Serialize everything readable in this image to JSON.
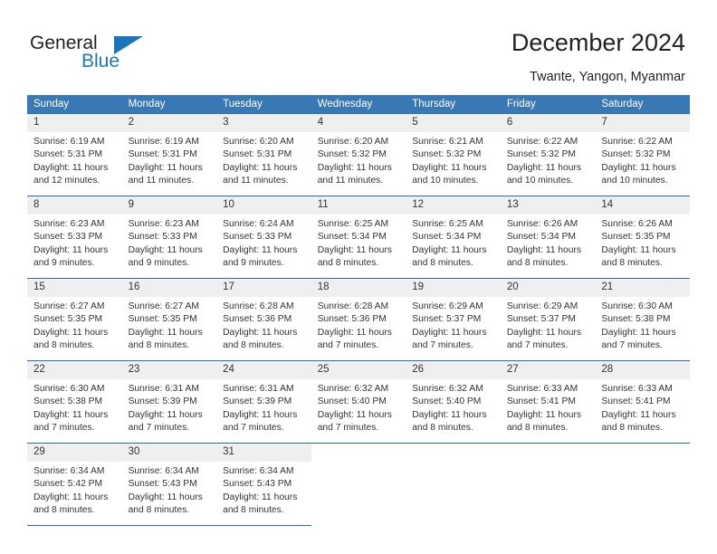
{
  "brand": {
    "word_one": "General",
    "word_two": "Blue",
    "accent_color": "#1b75bb"
  },
  "header": {
    "title": "December 2024",
    "subtitle": "Twante, Yangon, Myanmar"
  },
  "calendar": {
    "header_color": "#3878b4",
    "daynum_background": "#efefef",
    "weekday_headers": [
      "Sunday",
      "Monday",
      "Tuesday",
      "Wednesday",
      "Thursday",
      "Friday",
      "Saturday"
    ],
    "weeks": [
      [
        {
          "day": "1",
          "sunrise": "Sunrise: 6:19 AM",
          "sunset": "Sunset: 5:31 PM",
          "daylight_line1": "Daylight: 11 hours",
          "daylight_line2": "and 12 minutes."
        },
        {
          "day": "2",
          "sunrise": "Sunrise: 6:19 AM",
          "sunset": "Sunset: 5:31 PM",
          "daylight_line1": "Daylight: 11 hours",
          "daylight_line2": "and 11 minutes."
        },
        {
          "day": "3",
          "sunrise": "Sunrise: 6:20 AM",
          "sunset": "Sunset: 5:31 PM",
          "daylight_line1": "Daylight: 11 hours",
          "daylight_line2": "and 11 minutes."
        },
        {
          "day": "4",
          "sunrise": "Sunrise: 6:20 AM",
          "sunset": "Sunset: 5:32 PM",
          "daylight_line1": "Daylight: 11 hours",
          "daylight_line2": "and 11 minutes."
        },
        {
          "day": "5",
          "sunrise": "Sunrise: 6:21 AM",
          "sunset": "Sunset: 5:32 PM",
          "daylight_line1": "Daylight: 11 hours",
          "daylight_line2": "and 10 minutes."
        },
        {
          "day": "6",
          "sunrise": "Sunrise: 6:22 AM",
          "sunset": "Sunset: 5:32 PM",
          "daylight_line1": "Daylight: 11 hours",
          "daylight_line2": "and 10 minutes."
        },
        {
          "day": "7",
          "sunrise": "Sunrise: 6:22 AM",
          "sunset": "Sunset: 5:32 PM",
          "daylight_line1": "Daylight: 11 hours",
          "daylight_line2": "and 10 minutes."
        }
      ],
      [
        {
          "day": "8",
          "sunrise": "Sunrise: 6:23 AM",
          "sunset": "Sunset: 5:33 PM",
          "daylight_line1": "Daylight: 11 hours",
          "daylight_line2": "and 9 minutes."
        },
        {
          "day": "9",
          "sunrise": "Sunrise: 6:23 AM",
          "sunset": "Sunset: 5:33 PM",
          "daylight_line1": "Daylight: 11 hours",
          "daylight_line2": "and 9 minutes."
        },
        {
          "day": "10",
          "sunrise": "Sunrise: 6:24 AM",
          "sunset": "Sunset: 5:33 PM",
          "daylight_line1": "Daylight: 11 hours",
          "daylight_line2": "and 9 minutes."
        },
        {
          "day": "11",
          "sunrise": "Sunrise: 6:25 AM",
          "sunset": "Sunset: 5:34 PM",
          "daylight_line1": "Daylight: 11 hours",
          "daylight_line2": "and 8 minutes."
        },
        {
          "day": "12",
          "sunrise": "Sunrise: 6:25 AM",
          "sunset": "Sunset: 5:34 PM",
          "daylight_line1": "Daylight: 11 hours",
          "daylight_line2": "and 8 minutes."
        },
        {
          "day": "13",
          "sunrise": "Sunrise: 6:26 AM",
          "sunset": "Sunset: 5:34 PM",
          "daylight_line1": "Daylight: 11 hours",
          "daylight_line2": "and 8 minutes."
        },
        {
          "day": "14",
          "sunrise": "Sunrise: 6:26 AM",
          "sunset": "Sunset: 5:35 PM",
          "daylight_line1": "Daylight: 11 hours",
          "daylight_line2": "and 8 minutes."
        }
      ],
      [
        {
          "day": "15",
          "sunrise": "Sunrise: 6:27 AM",
          "sunset": "Sunset: 5:35 PM",
          "daylight_line1": "Daylight: 11 hours",
          "daylight_line2": "and 8 minutes."
        },
        {
          "day": "16",
          "sunrise": "Sunrise: 6:27 AM",
          "sunset": "Sunset: 5:35 PM",
          "daylight_line1": "Daylight: 11 hours",
          "daylight_line2": "and 8 minutes."
        },
        {
          "day": "17",
          "sunrise": "Sunrise: 6:28 AM",
          "sunset": "Sunset: 5:36 PM",
          "daylight_line1": "Daylight: 11 hours",
          "daylight_line2": "and 8 minutes."
        },
        {
          "day": "18",
          "sunrise": "Sunrise: 6:28 AM",
          "sunset": "Sunset: 5:36 PM",
          "daylight_line1": "Daylight: 11 hours",
          "daylight_line2": "and 7 minutes."
        },
        {
          "day": "19",
          "sunrise": "Sunrise: 6:29 AM",
          "sunset": "Sunset: 5:37 PM",
          "daylight_line1": "Daylight: 11 hours",
          "daylight_line2": "and 7 minutes."
        },
        {
          "day": "20",
          "sunrise": "Sunrise: 6:29 AM",
          "sunset": "Sunset: 5:37 PM",
          "daylight_line1": "Daylight: 11 hours",
          "daylight_line2": "and 7 minutes."
        },
        {
          "day": "21",
          "sunrise": "Sunrise: 6:30 AM",
          "sunset": "Sunset: 5:38 PM",
          "daylight_line1": "Daylight: 11 hours",
          "daylight_line2": "and 7 minutes."
        }
      ],
      [
        {
          "day": "22",
          "sunrise": "Sunrise: 6:30 AM",
          "sunset": "Sunset: 5:38 PM",
          "daylight_line1": "Daylight: 11 hours",
          "daylight_line2": "and 7 minutes."
        },
        {
          "day": "23",
          "sunrise": "Sunrise: 6:31 AM",
          "sunset": "Sunset: 5:39 PM",
          "daylight_line1": "Daylight: 11 hours",
          "daylight_line2": "and 7 minutes."
        },
        {
          "day": "24",
          "sunrise": "Sunrise: 6:31 AM",
          "sunset": "Sunset: 5:39 PM",
          "daylight_line1": "Daylight: 11 hours",
          "daylight_line2": "and 7 minutes."
        },
        {
          "day": "25",
          "sunrise": "Sunrise: 6:32 AM",
          "sunset": "Sunset: 5:40 PM",
          "daylight_line1": "Daylight: 11 hours",
          "daylight_line2": "and 7 minutes."
        },
        {
          "day": "26",
          "sunrise": "Sunrise: 6:32 AM",
          "sunset": "Sunset: 5:40 PM",
          "daylight_line1": "Daylight: 11 hours",
          "daylight_line2": "and 8 minutes."
        },
        {
          "day": "27",
          "sunrise": "Sunrise: 6:33 AM",
          "sunset": "Sunset: 5:41 PM",
          "daylight_line1": "Daylight: 11 hours",
          "daylight_line2": "and 8 minutes."
        },
        {
          "day": "28",
          "sunrise": "Sunrise: 6:33 AM",
          "sunset": "Sunset: 5:41 PM",
          "daylight_line1": "Daylight: 11 hours",
          "daylight_line2": "and 8 minutes."
        }
      ],
      [
        {
          "day": "29",
          "sunrise": "Sunrise: 6:34 AM",
          "sunset": "Sunset: 5:42 PM",
          "daylight_line1": "Daylight: 11 hours",
          "daylight_line2": "and 8 minutes."
        },
        {
          "day": "30",
          "sunrise": "Sunrise: 6:34 AM",
          "sunset": "Sunset: 5:43 PM",
          "daylight_line1": "Daylight: 11 hours",
          "daylight_line2": "and 8 minutes."
        },
        {
          "day": "31",
          "sunrise": "Sunrise: 6:34 AM",
          "sunset": "Sunset: 5:43 PM",
          "daylight_line1": "Daylight: 11 hours",
          "daylight_line2": "and 8 minutes."
        },
        {
          "day": "",
          "sunrise": "",
          "sunset": "",
          "daylight_line1": "",
          "daylight_line2": ""
        },
        {
          "day": "",
          "sunrise": "",
          "sunset": "",
          "daylight_line1": "",
          "daylight_line2": ""
        },
        {
          "day": "",
          "sunrise": "",
          "sunset": "",
          "daylight_line1": "",
          "daylight_line2": ""
        },
        {
          "day": "",
          "sunrise": "",
          "sunset": "",
          "daylight_line1": "",
          "daylight_line2": ""
        }
      ]
    ]
  }
}
